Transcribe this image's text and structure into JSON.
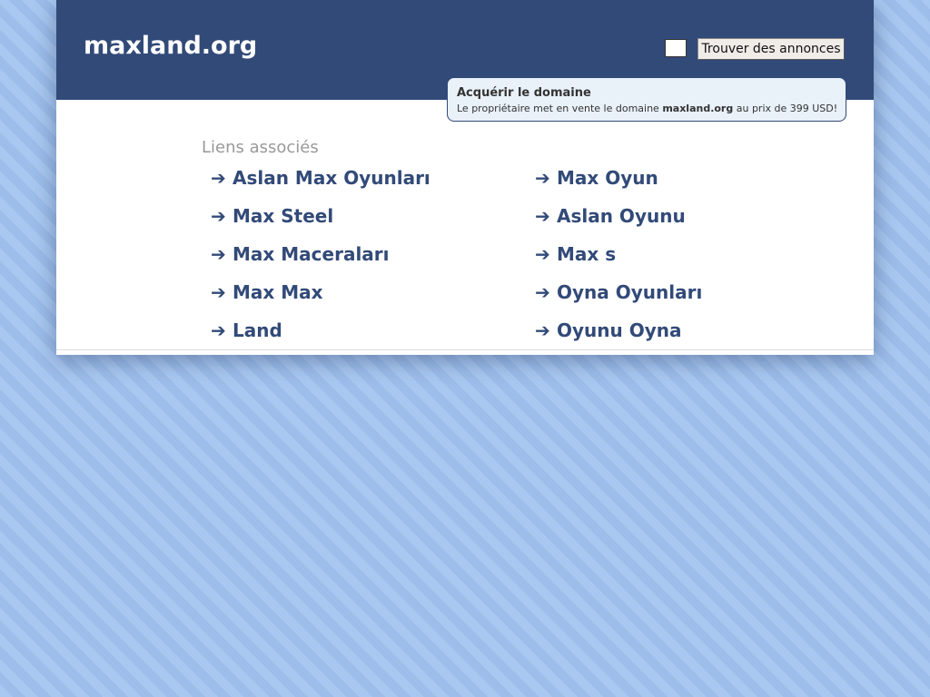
{
  "header": {
    "site_title": "maxland.org",
    "search_value": "",
    "search_button": "Trouver des annonces"
  },
  "sale_notice": {
    "title": "Acquérir le domaine",
    "text_before": "Le propriétaire met en vente le domaine ",
    "domain": "maxland.org",
    "text_after": " au prix de 399 USD!"
  },
  "related": {
    "heading": "Liens associés",
    "arrow_glyph": "➔",
    "left_links": [
      "Aslan Max Oyunları",
      "Max Steel",
      "Max Maceraları",
      "Max Max",
      "Land"
    ],
    "right_links": [
      "Max Oyun",
      "Aslan Oyunu",
      "Max s",
      "Oyna Oyunları",
      "Oyunu Oyna"
    ]
  },
  "colors": {
    "header_bg": "#324a78",
    "link": "#324a78",
    "heading_gray": "#999999",
    "notice_bg": "#e9f1f9",
    "page_bg": "#a3c3ee"
  }
}
